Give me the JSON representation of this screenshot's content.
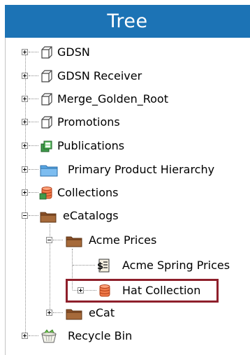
{
  "panel": {
    "title": "Tree"
  },
  "tree": {
    "gdsn": "GDSN",
    "gdsn_receiver": "GDSN Receiver",
    "merge_golden_root": "Merge_Golden_Root",
    "promotions": "Promotions",
    "publications": "Publications",
    "primary_product_hierarchy": "Primary Product Hierarchy",
    "collections": "Collections",
    "ecatalogs": "eCatalogs",
    "acme_prices": "Acme Prices",
    "acme_spring_prices": "Acme Spring Prices",
    "hat_collection": "Hat Collection",
    "ecat": "eCat",
    "recycle_bin": "Recycle Bin"
  },
  "selected_item": "Hat Collection",
  "colors": {
    "header_bg": "#1c73b5",
    "highlight_border": "#8e1f2b",
    "folder_brown": "#a66a3a",
    "collection_orange": "#f07a4a",
    "hierarchy_blue": "#5aa8e6",
    "publication_green": "#3f9a4a"
  },
  "icons": {
    "gdsn": "cube-outline-icon",
    "publications": "publications-icon",
    "hierarchy": "blue-folder-icon",
    "collections": "database-icon",
    "folder": "brown-folder-icon",
    "price_list": "price-list-icon",
    "recycle_bin": "recycle-bin-icon"
  }
}
